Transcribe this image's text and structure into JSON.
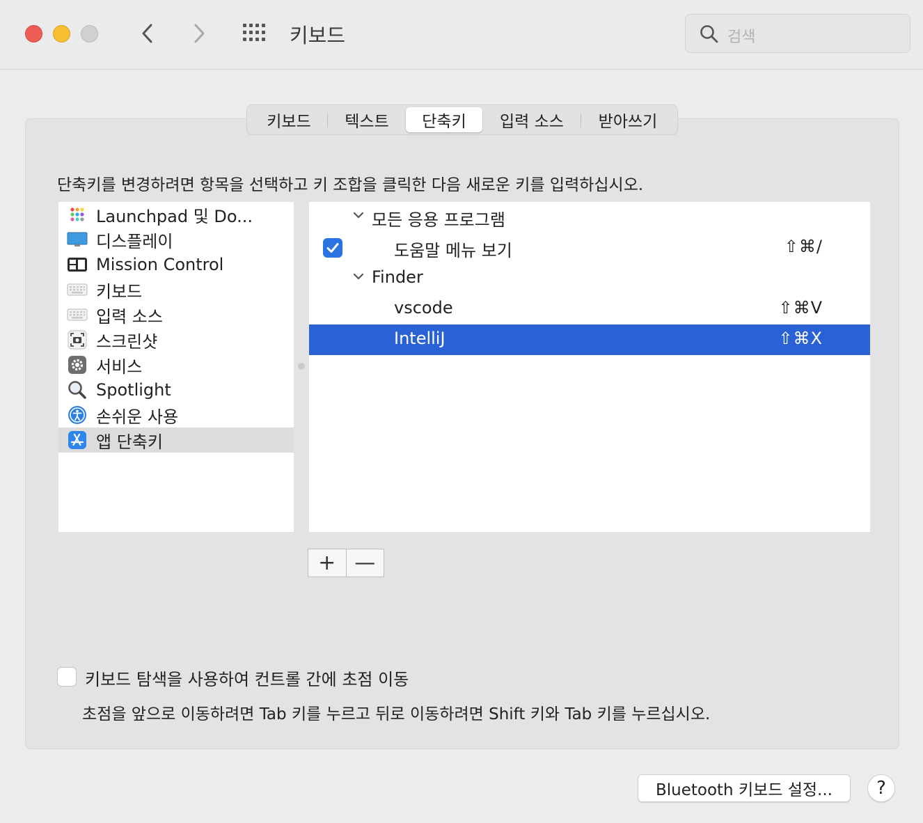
{
  "window": {
    "title": "키보드"
  },
  "search": {
    "placeholder": "검색"
  },
  "tabs": [
    {
      "label": "키보드"
    },
    {
      "label": "텍스트"
    },
    {
      "label": "단축키"
    },
    {
      "label": "입력 소스"
    },
    {
      "label": "받아쓰기"
    }
  ],
  "active_tab": "단축키",
  "instruction": "단축키를 변경하려면 항목을 선택하고 키 조합을 클릭한 다음 새로운 키를 입력하십시오.",
  "categories": [
    {
      "label": "Launchpad 및 Do...",
      "icon": "launchpad-icon"
    },
    {
      "label": "디스플레이",
      "icon": "display-icon"
    },
    {
      "label": "Mission Control",
      "icon": "mission-control-icon"
    },
    {
      "label": "키보드",
      "icon": "keyboard-icon"
    },
    {
      "label": "입력 소스",
      "icon": "keyboard-icon"
    },
    {
      "label": "스크린샷",
      "icon": "screenshot-icon"
    },
    {
      "label": "서비스",
      "icon": "gear-icon"
    },
    {
      "label": "Spotlight",
      "icon": "magnifier-icon"
    },
    {
      "label": "손쉬운 사용",
      "icon": "accessibility-icon"
    },
    {
      "label": "앱 단축키",
      "icon": "app-store-icon",
      "selected": true
    }
  ],
  "shortcuts": {
    "group1": {
      "label": "모든 응용 프로그램"
    },
    "item1": {
      "label": "도움말 메뉴 보기",
      "keys": "⇧⌘/",
      "checked": true
    },
    "group2": {
      "label": "Finder"
    },
    "item2": {
      "label": "vscode",
      "keys": "⇧⌘V"
    },
    "item3": {
      "label": "IntelliJ",
      "keys": "⇧⌘X",
      "selected": true
    }
  },
  "buttons": {
    "add": "+",
    "remove": "—",
    "bluetooth": "Bluetooth 키보드 설정...",
    "help": "?"
  },
  "keyboard_nav": {
    "label": "키보드 탐색을 사용하여 컨트롤 간에 초점 이동",
    "checked": false,
    "note": "초점을 앞으로 이동하려면 Tab 키를 누르고 뒤로 이동하려면 Shift 키와 Tab 키를 누르십시오."
  },
  "colors": {
    "selection": "#2a62d6",
    "checkbox": "#2b73e0"
  }
}
